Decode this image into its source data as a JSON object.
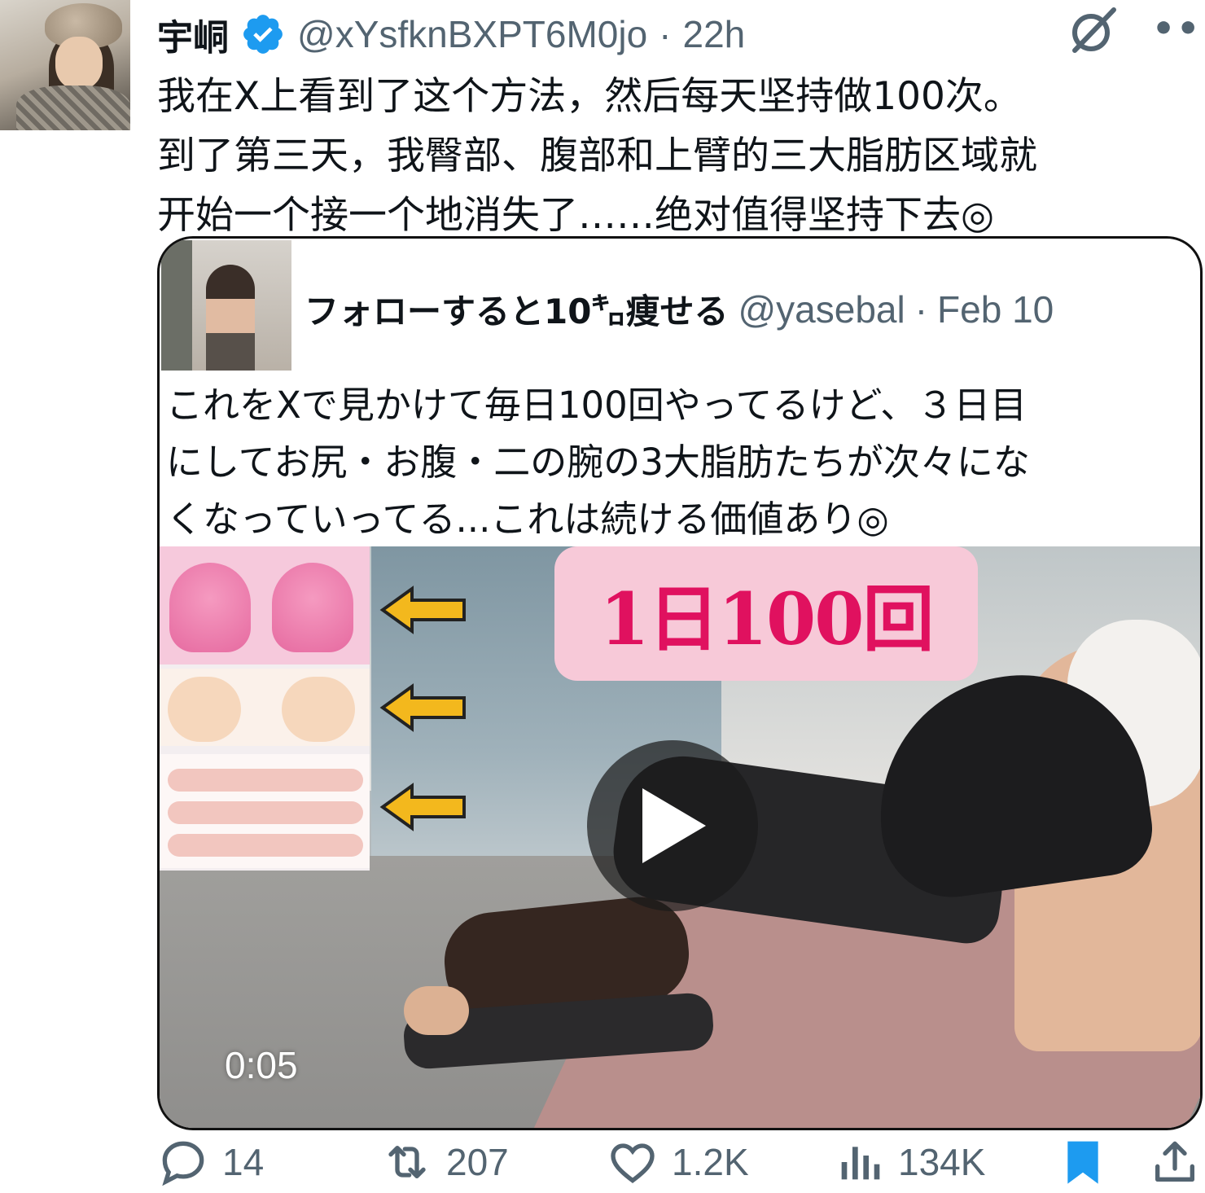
{
  "tweet": {
    "author_name": "宇峒",
    "handle": "@xYsfknBXPT6M0jo",
    "separator": "·",
    "time": "22h",
    "text": "我在X上看到了这个方法，然后每天坚持做100次。\n到了第三天，我臀部、腹部和上臂的三大脂肪区域就\n开始一个接一个地消失了……绝对值得坚持下去◎"
  },
  "quoted": {
    "author_name": "フォローすると10㌔痩せる",
    "handle": "@yasebal",
    "separator": "·",
    "time": "Feb 10",
    "text": "これをXで見かけて毎日100回やってるけど、３日目\nにしてお尻・お腹・二の腕の3大脂肪たちが次々にな\nくなっていってる...これは続ける価値あり◎",
    "video": {
      "overlay_text": "1日100回",
      "duration": "0:05"
    }
  },
  "actions": {
    "replies": "14",
    "reposts": "207",
    "likes": "1.2K",
    "views": "134K"
  },
  "colors": {
    "verified": "#1d9bf0",
    "bookmark": "#1d9bf0",
    "muted": "#536471",
    "text": "#0f1419",
    "video_badge_text": "#e0115f"
  },
  "icons": [
    "verified-icon",
    "grok-icon",
    "more-icon",
    "reply-icon",
    "repost-icon",
    "like-icon",
    "views-icon",
    "bookmark-icon",
    "share-icon",
    "play-icon"
  ]
}
